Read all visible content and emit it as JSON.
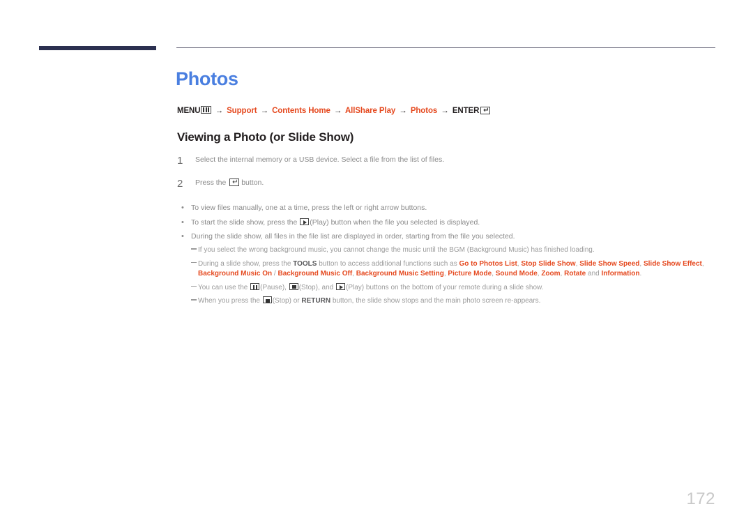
{
  "document": {
    "page_number": "172",
    "title": "Photos",
    "section_heading": "Viewing a Photo (or Slide Show)"
  },
  "colors": {
    "title_blue": "#4a7fe0",
    "accent_orange": "#e5491f",
    "header_bar_navy": "#2b3050",
    "body_gray": "#8a8a8a",
    "note_gray": "#9a9a9a",
    "page_number_gray": "#c8c8c8"
  },
  "breadcrumb": {
    "items": [
      {
        "label": "MENU",
        "icon": "menu-icon",
        "style": "plain"
      },
      {
        "label": "Support",
        "style": "accent"
      },
      {
        "label": "Contents Home",
        "style": "accent"
      },
      {
        "label": "AllShare Play",
        "style": "accent"
      },
      {
        "label": "Photos",
        "style": "accent"
      },
      {
        "label": "ENTER",
        "icon": "enter-icon",
        "style": "plain"
      }
    ],
    "separator": "→"
  },
  "steps": [
    {
      "number": "1",
      "text": "Select the internal memory or a USB device. Select a file from the list of files."
    },
    {
      "number": "2",
      "text_before": "Press the ",
      "icon": "enter-icon",
      "text_after": " button."
    }
  ],
  "bullets": [
    {
      "marker": "•",
      "text": "To view files manually, one at a time, press the left or right arrow buttons."
    },
    {
      "marker": "•",
      "text_before": "To start the slide show, press the ",
      "icon": "play-icon",
      "text_after": "(Play) button when the file you selected is displayed."
    },
    {
      "marker": "•",
      "text": "During the slide show, all files in the file list are displayed in order, starting from the file you selected."
    }
  ],
  "notes": [
    {
      "id": "note-bgm",
      "text": "If you select the wrong background music, you cannot change the music until the BGM (Background Music) has finished loading."
    },
    {
      "id": "note-tools",
      "line1_before": "During a slide show, press the ",
      "line1_bold": "TOOLS",
      "line1_after": " button to access additional functions such as ",
      "terms": [
        "Go to Photos List",
        "Stop Slide Show",
        "Slide Show Speed",
        "Slide Show Effect",
        "Background Music On",
        "Background Music Off",
        "Background Music Setting",
        "Picture Mode",
        "Sound Mode",
        "Zoom",
        "Rotate",
        "Information"
      ],
      "separators": [
        ", ",
        ", ",
        ", ",
        ", ",
        " / ",
        ", ",
        ", ",
        ", ",
        ", ",
        ", ",
        " and ",
        "."
      ]
    },
    {
      "id": "note-remote-buttons",
      "p1": "You can use the ",
      "icon1": "pause-icon",
      "p2": "(Pause), ",
      "icon2": "stop-icon",
      "p3": "(Stop), and ",
      "icon3": "play-icon",
      "p4": "(Play) buttons on the bottom of your remote during a slide show."
    },
    {
      "id": "note-stop-return",
      "p1": "When you press the ",
      "icon1": "stop-icon",
      "p2": "(Stop) or ",
      "bold1": "RETURN",
      "p3": " button, the slide show stops and the main photo screen re-appears."
    }
  ]
}
